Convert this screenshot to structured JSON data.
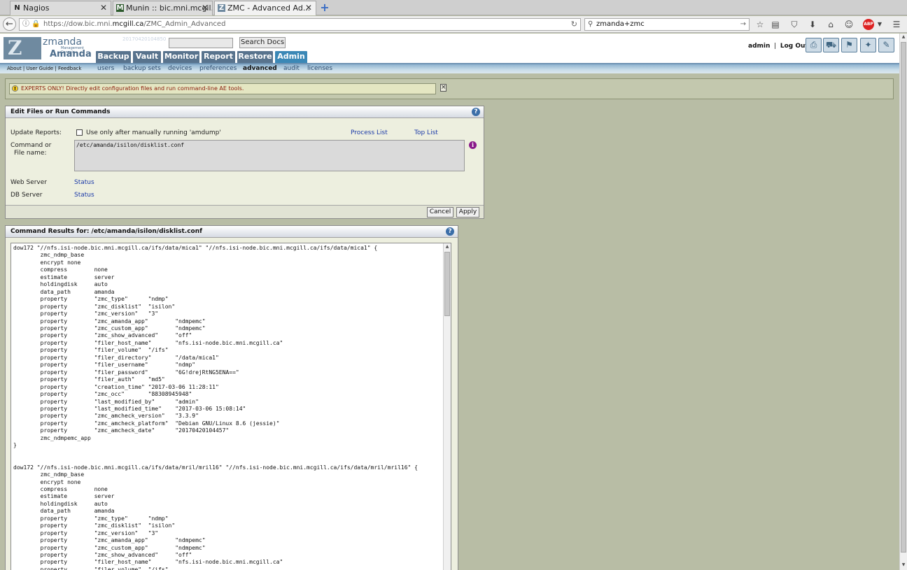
{
  "browser": {
    "tabs": [
      {
        "favicon": "N",
        "title": "Nagios"
      },
      {
        "favicon": "M",
        "title": "Munin :: bic.mni.mcgil..."
      },
      {
        "favicon": "Z",
        "title": "ZMC - Advanced Ad..."
      }
    ],
    "url_prefix": "https://dow.bic.mni.",
    "url_host": "mcgill.ca",
    "url_path": "/ZMC_Admin_Advanced",
    "search_value": "zmanda+zmc",
    "abp_label": "ABP"
  },
  "header": {
    "logo_top": "zmanda",
    "logo_sub": "Management Console",
    "logo_main": "Amanda",
    "ghost_date": "20170420104850",
    "search_button": "Search Docs",
    "main_tabs": [
      "Backup",
      "Vault",
      "Monitor",
      "Report",
      "Restore",
      "Admin"
    ],
    "user": "admin",
    "logout": "Log Out",
    "about_links": "About | User Guide | Feedback",
    "sub_nav": [
      "users",
      "backup sets",
      "devices",
      "preferences",
      "advanced",
      "audit",
      "licenses"
    ]
  },
  "message": {
    "text": "EXPERTS ONLY! Directly edit configuration files and run command-line AE tools."
  },
  "edit_panel": {
    "title": "Edit Files or Run Commands",
    "update_reports_label": "Update Reports:",
    "checkbox_label": "Use only after manually running 'amdump'",
    "process_list": "Process List",
    "top_list": "Top List",
    "command_label_1": "Command or",
    "command_label_2": "File name:",
    "command_value": "/etc/amanda/isilon/disklist.conf",
    "web_server_label": "Web Server",
    "web_server_status": "Status",
    "db_server_label": "DB Server",
    "db_server_status": "Status",
    "cancel": "Cancel",
    "apply": "Apply"
  },
  "results_panel": {
    "title": "Command Results for: /etc/amanda/isilon/disklist.conf",
    "lines": [
      "dow172 \"//nfs.isi-node.bic.mni.mcgill.ca/ifs/data/mica1\" \"//nfs.isi-node.bic.mni.mcgill.ca/ifs/data/mica1\" {",
      "        zmc_ndmp_base",
      "        encrypt none",
      "        compress        none",
      "        estimate        server",
      "        holdingdisk     auto",
      "        data_path       amanda",
      "        property        \"zmc_type\"      \"ndmp\"",
      "        property        \"zmc_disklist\"  \"isilon\"",
      "        property        \"zmc_version\"   \"3\"",
      "        property        \"zmc_amanda_app\"        \"ndmpemc\"",
      "        property        \"zmc_custom_app\"        \"ndmpemc\"",
      "        property        \"zmc_show_advanced\"     \"off\"",
      "        property        \"filer_host_name\"       \"nfs.isi-node.bic.mni.mcgill.ca\"",
      "        property        \"filer_volume\"  \"/ifs\"",
      "        property        \"filer_directory\"       \"/data/mica1\"",
      "        property        \"filer_username\"        \"ndmp\"",
      "        property        \"filer_password\"        \"6G!drejRtNG5ENA==\"",
      "        property        \"filer_auth\"    \"md5\"",
      "        property        \"creation_time\" \"2017-03-06 11:28:11\"",
      "        property        \"zmc_occ\"       \"88308945948\"",
      "        property        \"last_modified_by\"      \"admin\"",
      "        property        \"last_modified_time\"    \"2017-03-06 15:08:14\"",
      "        property        \"zmc_amcheck_version\"   \"3.3.9\"",
      "        property        \"zmc_amcheck_platform\"  \"Debian GNU/Linux 8.6 (jessie)\"",
      "        property        \"zmc_amcheck_date\"      \"20170420104457\"",
      "        zmc_ndmpemc_app",
      "}",
      "",
      "",
      "dow172 \"//nfs.isi-node.bic.mni.mcgill.ca/ifs/data/mril/mril16\" \"//nfs.isi-node.bic.mni.mcgill.ca/ifs/data/mril/mril16\" {",
      "        zmc_ndmp_base",
      "        encrypt none",
      "        compress        none",
      "        estimate        server",
      "        holdingdisk     auto",
      "        data_path       amanda",
      "        property        \"zmc_type\"      \"ndmp\"",
      "        property        \"zmc_disklist\"  \"isilon\"",
      "        property        \"zmc_version\"   \"3\"",
      "        property        \"zmc_amanda_app\"        \"ndmpemc\"",
      "        property        \"zmc_custom_app\"        \"ndmpemc\"",
      "        property        \"zmc_show_advanced\"     \"off\"",
      "        property        \"filer_host_name\"       \"nfs.isi-node.bic.mni.mcgill.ca\"",
      "        property        \"filer_volume\"  \"/ifs\""
    ]
  }
}
